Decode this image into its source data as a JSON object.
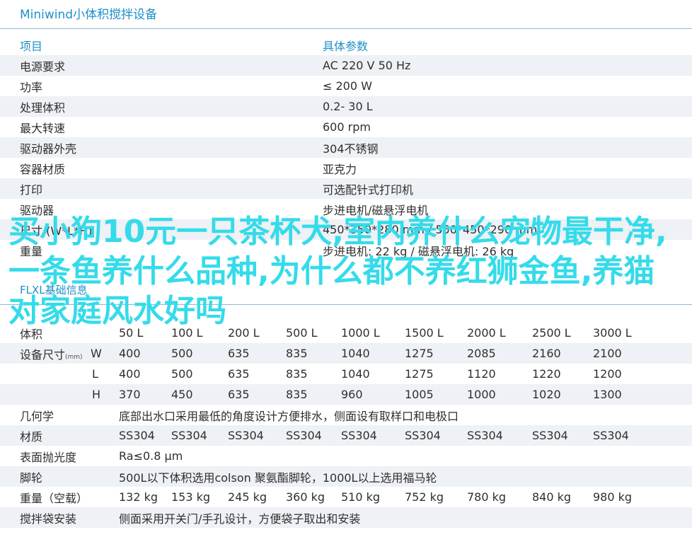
{
  "title": "Miniwind小体积搅拌设备",
  "spec_table": {
    "header": [
      "项目",
      "具体参数"
    ],
    "rows": [
      [
        "电源要求",
        "AC 220 V 50 Hz"
      ],
      [
        "功率",
        "≤ 200 W"
      ],
      [
        "处理体积",
        "0.2- 30 L"
      ],
      [
        "最大转速",
        "600 rpm"
      ],
      [
        "驱动器外壳",
        "304不锈钢"
      ],
      [
        "容器材质",
        "亚克力"
      ],
      [
        "打印",
        "可选配针式打印机"
      ],
      [
        "驱动器",
        "步进电机/磁悬浮电机"
      ],
      [
        "尺寸 (W*L*H)",
        "450*350*280 mm / 550*450*290 mm"
      ],
      [
        "重量",
        "步进电机: 22 kg / 磁悬浮电机: 26 kg"
      ]
    ]
  },
  "section2_title": "FLXL基础信息",
  "overlay_text": "买小狗10元一只茶杯犬,室内养什么宠物最干净,一条鱼养什么品种,为什么都不养红狮金鱼,养猫对家庭风水好吗",
  "flxl_table": {
    "volume_label": "体积",
    "volumes": [
      "50 L",
      "100 L",
      "200 L",
      "500 L",
      "1000 L",
      "1500 L",
      "2000 L",
      "2500 L",
      "3000 L"
    ],
    "size_label": "设备尺寸",
    "size_unit": "(mm)",
    "w_label": "W",
    "l_label": "L",
    "h_label": "H",
    "w": [
      "400",
      "500",
      "635",
      "835",
      "1040",
      "1275",
      "2085",
      "2160",
      "2100"
    ],
    "l": [
      "400",
      "500",
      "635",
      "835",
      "1040",
      "1275",
      "1120",
      "1220",
      "1200"
    ],
    "h": [
      "370",
      "450",
      "635",
      "835",
      "960",
      "1005",
      "1000",
      "1020",
      "1300"
    ],
    "geometry_label": "几何学",
    "geometry": "底部出水口采用最低的角度设计方便排水，侧面设有取样口和电极口",
    "material_label": "材质",
    "materials": [
      "SS304",
      "SS304",
      "SS304",
      "SS304",
      "SS304",
      "SS304",
      "SS304",
      "SS304",
      "SS304"
    ],
    "polish_label": "表面抛光度",
    "polish": "Ra≤0.8 μm",
    "wheel_label": "脚轮",
    "wheel": "500L以下体积选用colson 聚氨酯脚轮，1000L以上选用福马轮",
    "weight_label": "重量（空载）",
    "weights": [
      "132 kg",
      "153 kg",
      "245 kg",
      "360 kg",
      "510 kg",
      "752 kg",
      "780 kg",
      "840 kg",
      "980 kg"
    ],
    "install_label": "搅拌袋安装",
    "install": "侧面采用开关门/手孔设计，方便袋子取出和安装"
  }
}
